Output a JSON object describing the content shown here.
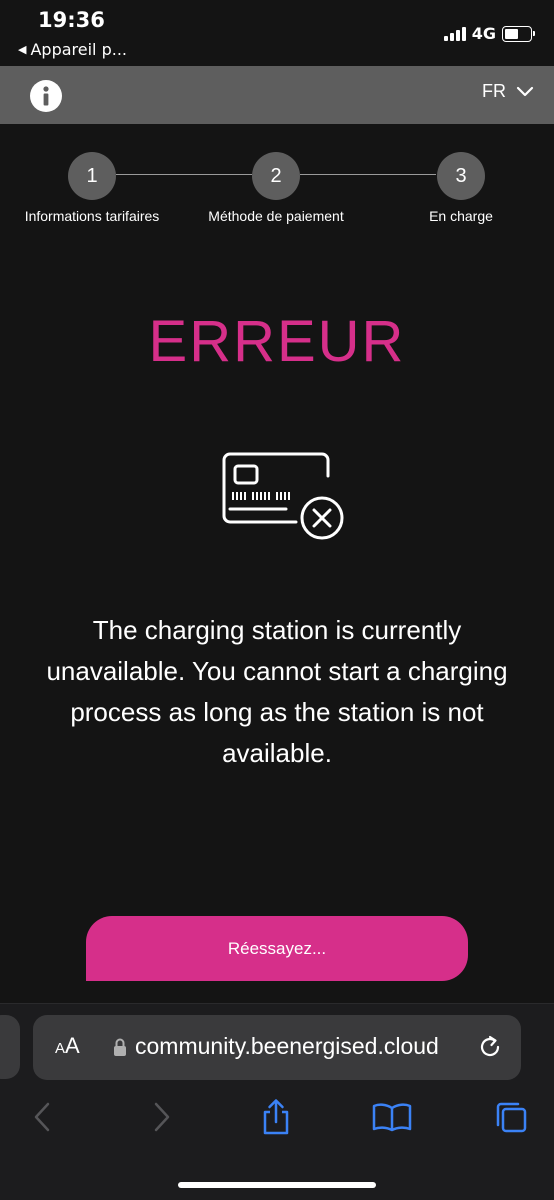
{
  "status_bar": {
    "time": "19:36",
    "back_app": "Appareil p...",
    "network": "4G"
  },
  "header": {
    "info_icon": "info-icon",
    "language": "FR"
  },
  "stepper": {
    "steps": [
      {
        "number": "1",
        "label": "Informations tarifaires"
      },
      {
        "number": "2",
        "label": "Méthode de paiement"
      },
      {
        "number": "3",
        "label": "En charge"
      }
    ]
  },
  "main": {
    "title": "ERREUR",
    "icon": "credit-card-error-icon",
    "message": "The charging station is currently unavailable. You cannot start a charging process as long as the station is not available.",
    "retry_label": "Réessayez..."
  },
  "safari": {
    "text_size_label": "AA",
    "url": "community.beenergised.cloud"
  },
  "colors": {
    "accent": "#d62f8a",
    "background": "#141414",
    "header": "#5e5e5e",
    "safari_blue": "#3b82f6"
  }
}
